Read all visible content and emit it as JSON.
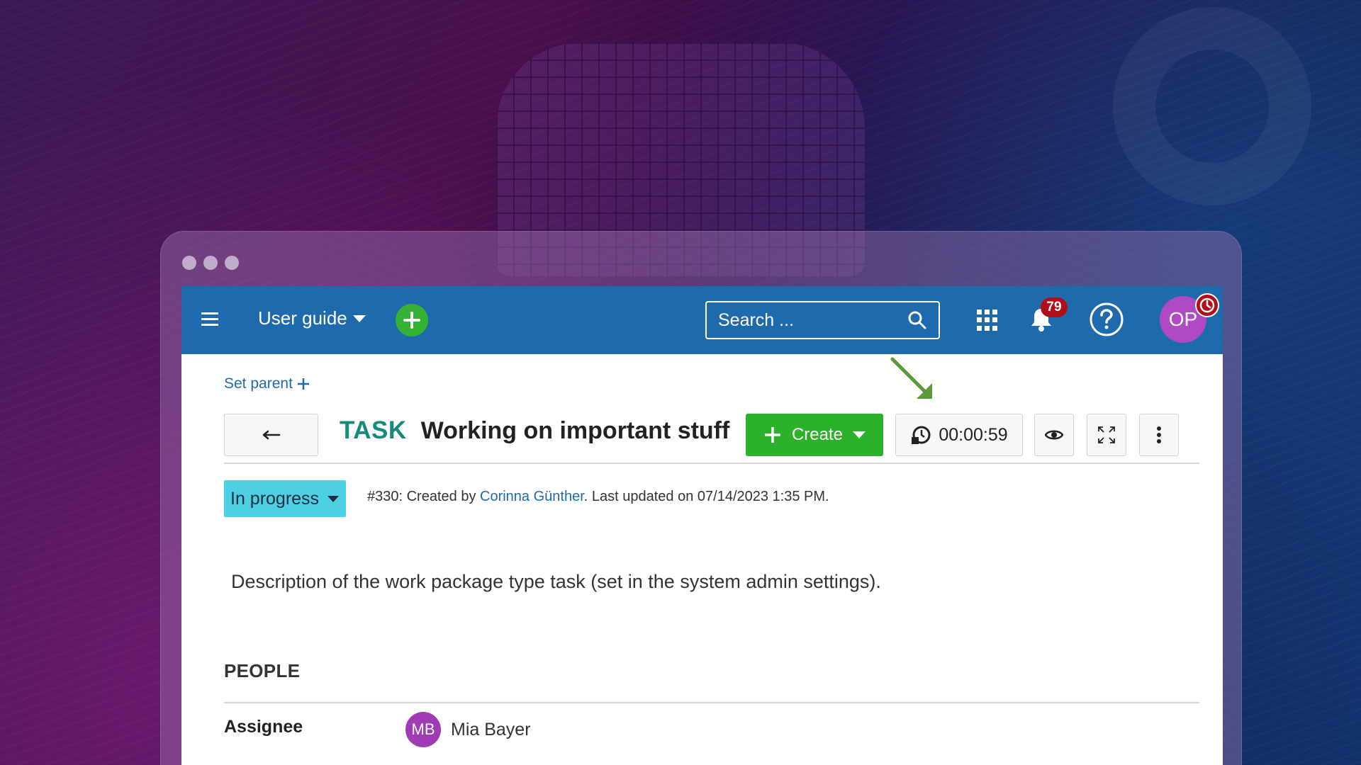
{
  "header": {
    "project": "User guide",
    "search_placeholder": "Search ...",
    "notifications_count": "79",
    "user_initials": "OP"
  },
  "workpackage": {
    "set_parent": "Set parent",
    "type": "TASK",
    "subject": "Working on important stuff",
    "create_label": "Create",
    "timer": "00:00:59",
    "status": "In progress",
    "meta_prefix": "#330: Created by ",
    "meta_author": "Corinna Günther",
    "meta_suffix": ". Last updated on 07/14/2023 1:35 PM.",
    "description": "Description of the work package type task (set in the system admin settings).",
    "people_section": "PEOPLE",
    "assignee_label": "Assignee",
    "assignee_initials": "MB",
    "assignee_name": "Mia Bayer"
  },
  "colors": {
    "header": "#1f6aac",
    "create": "#2cb12a",
    "status": "#4dd0e1",
    "type": "#168a7b",
    "badge": "#b20e17",
    "arrow": "#5a9a3c"
  },
  "icons": [
    "menu-icon",
    "plus-icon",
    "search-icon",
    "apps-grid-icon",
    "bell-icon",
    "help-icon",
    "timer-icon",
    "back-arrow-icon",
    "eye-icon",
    "fullscreen-icon",
    "more-vertical-icon"
  ]
}
